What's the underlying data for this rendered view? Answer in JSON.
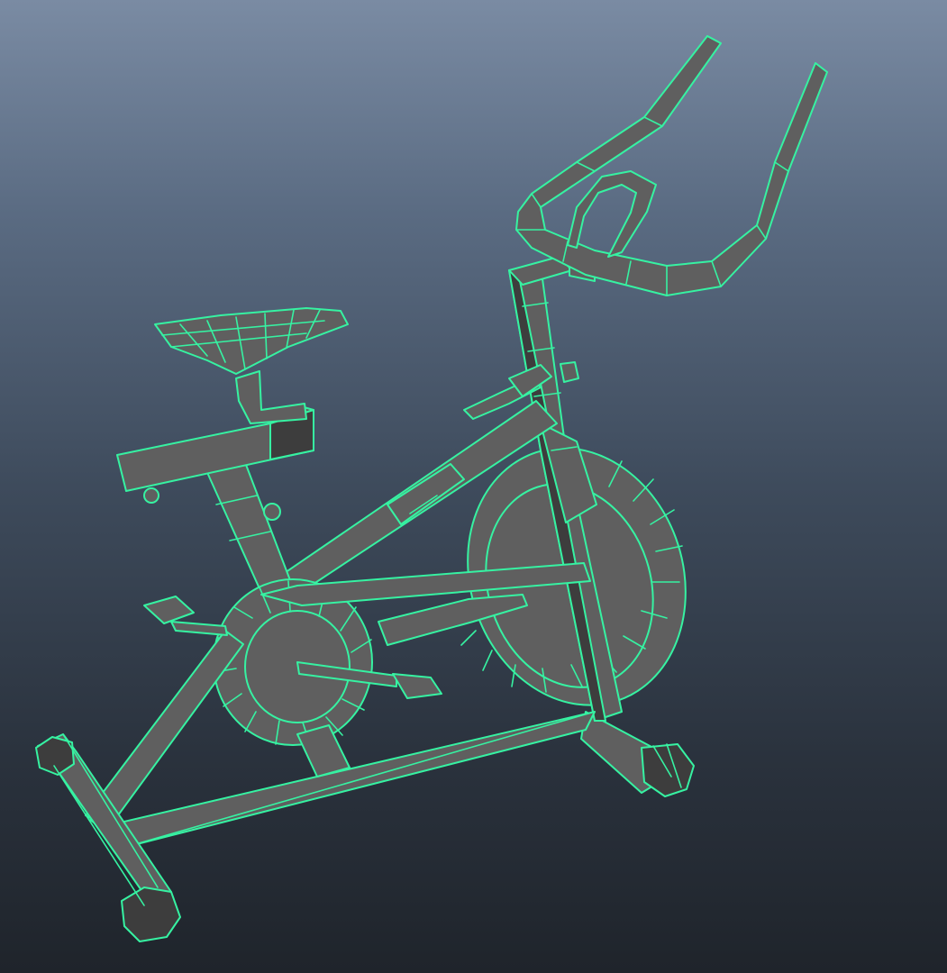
{
  "viewport": {
    "background_top": "#7a8ba3",
    "background_bottom": "#1f242b"
  },
  "model": {
    "wireframe_color": "#36f2a2",
    "shaded_color": "#5f5f5f"
  }
}
